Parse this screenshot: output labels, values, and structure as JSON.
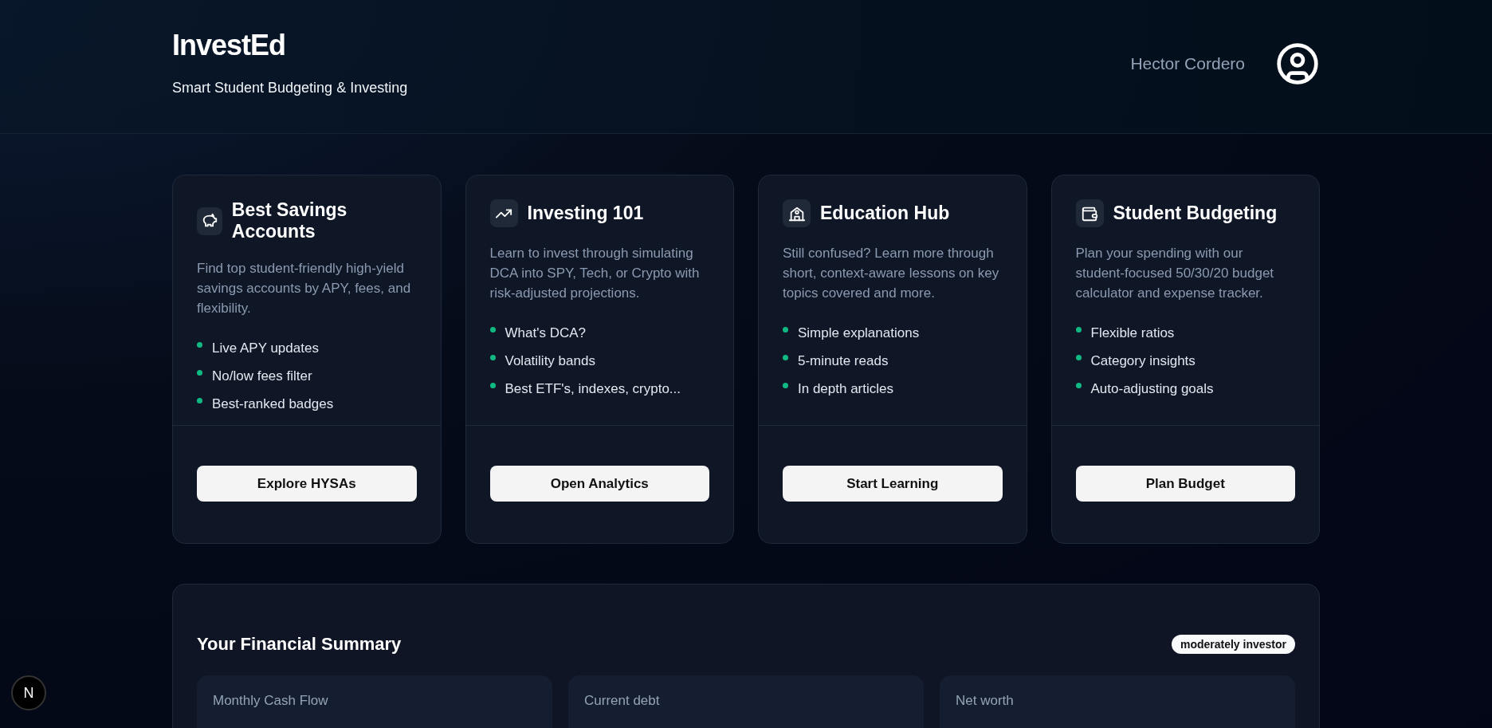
{
  "header": {
    "logo": "InvestEd",
    "tagline": "Smart Student Budgeting & Investing",
    "user_name": "Hector Cordero"
  },
  "cards": [
    {
      "title": "Best Savings Accounts",
      "description": "Find top student-friendly high-yield savings accounts by APY, fees, and flexibility.",
      "features": [
        "Live APY updates",
        "No/low fees filter",
        "Best-ranked badges"
      ],
      "button": "Explore HYSAs"
    },
    {
      "title": "Investing 101",
      "description": "Learn to invest through simulating DCA into SPY, Tech, or Crypto with risk-adjusted projections.",
      "features": [
        "What's DCA?",
        "Volatility bands",
        "Best ETF's, indexes, crypto..."
      ],
      "button": "Open Analytics"
    },
    {
      "title": "Education Hub",
      "description": "Still confused? Learn more through short, context-aware lessons on key topics covered and more.",
      "features": [
        "Simple explanations",
        "5-minute reads",
        "In depth articles"
      ],
      "button": "Start Learning"
    },
    {
      "title": "Student Budgeting",
      "description": "Plan your spending with our student-focused 50/30/20 budget calculator and expense tracker.",
      "features": [
        "Flexible ratios",
        "Category insights",
        "Auto-adjusting goals"
      ],
      "button": "Plan Budget"
    }
  ],
  "summary": {
    "title": "Your Financial Summary",
    "badge": "moderately investor",
    "stats": [
      {
        "label": "Monthly Cash Flow"
      },
      {
        "label": "Current debt"
      },
      {
        "label": "Net worth"
      }
    ]
  },
  "dev_badge": "N"
}
